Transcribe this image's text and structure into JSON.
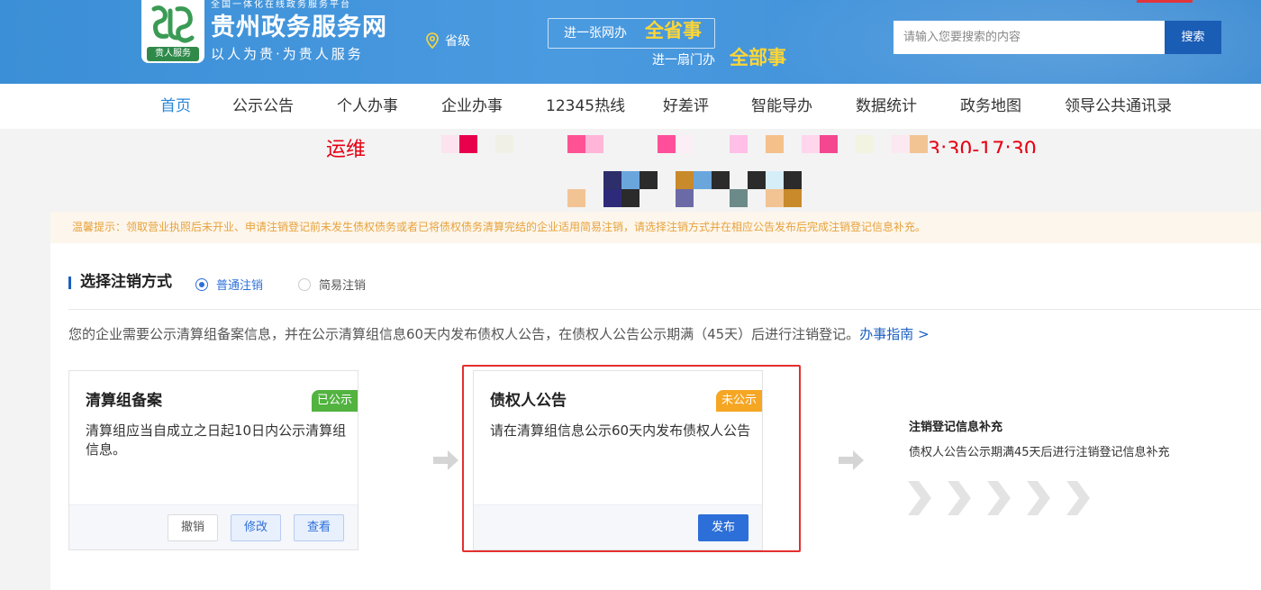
{
  "header": {
    "logo_badge": "贵人服务",
    "tagline": "全国一体化在线政务服务平台",
    "site_name": "贵州政务服务网",
    "slogan": "以人为贵·为贵人服务",
    "region": "省级",
    "promo": {
      "line1_prefix": "进一张网办",
      "line1_highlight": "全省事",
      "line2_prefix": "进一扇门办",
      "line2_highlight": "全部事"
    },
    "search": {
      "placeholder": "请输入您要搜索的内容",
      "button_label": "搜索"
    }
  },
  "nav": {
    "items": [
      {
        "label": "首页",
        "active": true
      },
      {
        "label": "公示公告"
      },
      {
        "label": "个人办事"
      },
      {
        "label": "企业办事"
      },
      {
        "label": "12345热线"
      },
      {
        "label": "好差评"
      },
      {
        "label": "智能导办"
      },
      {
        "label": "数据统计"
      },
      {
        "label": "政务地图"
      },
      {
        "label": "领导公共通讯录"
      }
    ]
  },
  "notice": {
    "red_start": "运维",
    "red_end": "3:30-17:30"
  },
  "tip": {
    "text": "温馨提示：领取营业执照后未开业、申请注销登记前未发生债权债务或者已将债权债务清算完结的企业适用简易注销，请选择注销方式并在相应公告发布后完成注销登记信息补充。"
  },
  "main": {
    "section_title": "选择注销方式",
    "options": [
      {
        "label": "普通注销",
        "selected": true
      },
      {
        "label": "简易注销",
        "selected": false
      }
    ],
    "description": "您的企业需要公示清算组备案信息，并在公示清算组信息60天内发布债权人公告，在债权人公告公示期满（45天）后进行注销登记。",
    "guide_link": "办事指南 >",
    "cards": [
      {
        "title": "清算组备案",
        "tag": "已公示",
        "tag_color": "#52b340",
        "body": "清算组应当自成立之日起10日内公示清算组信息。",
        "buttons": [
          "撤销",
          "修改",
          "查看"
        ]
      },
      {
        "title": "债权人公告",
        "tag": "未公示",
        "tag_color": "#f5a623",
        "body": "请在清算组信息公示60天内发布债权人公告",
        "buttons": [
          "发布"
        ]
      }
    ],
    "step3": {
      "title": "注销登记信息补充",
      "description": "债权人公告公示期满45天后进行注销登记信息补充"
    }
  },
  "colors": {
    "header_blue": "#3b8fd6",
    "search_button": "#1a5db5",
    "primary": "#2c6fd8",
    "highlight_border": "#e3302f",
    "tip_text": "#e6a23c",
    "notice_red": "#e60012"
  },
  "icons": [
    "logo-icon",
    "location-pin-icon",
    "radio-selected-icon",
    "radio-unselected-icon",
    "arrow-right-icon",
    "chevron-right-icon"
  ]
}
